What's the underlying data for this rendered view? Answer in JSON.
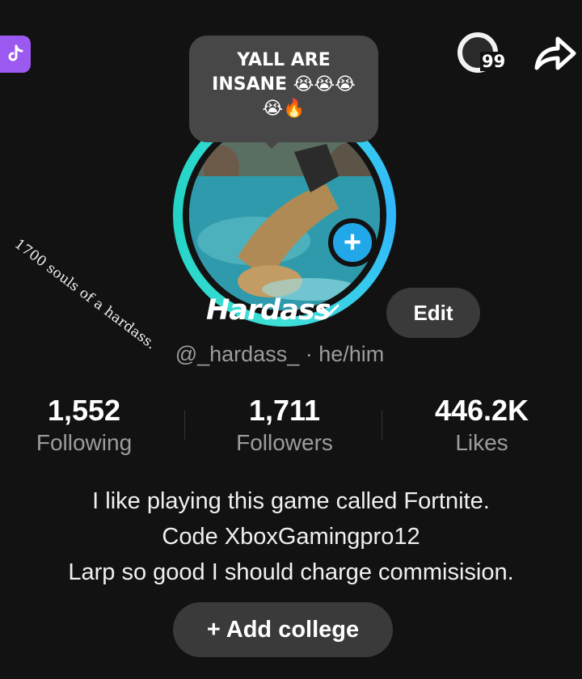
{
  "profile": {
    "display_name": "Hardass",
    "handle": "@_hardass_",
    "pronouns": "· he/him",
    "edit_label": "Edit"
  },
  "note": {
    "line1": "YALL ARE",
    "line2": "INSANE 😭😭😭",
    "line3": "😭🔥"
  },
  "overlay_text": "1700 souls of a hardass.",
  "header": {
    "notification_count": "99",
    "share_icon": "share-arrow-icon",
    "app_icon": "tiktok-icon"
  },
  "stats": [
    {
      "value": "1,552",
      "label": "Following"
    },
    {
      "value": "1,711",
      "label": "Followers"
    },
    {
      "value": "446.2K",
      "label": "Likes"
    }
  ],
  "bio": {
    "line1": "I like playing this game called Fortnite.",
    "line2": "Code XboxGamingpro12",
    "line3": "Larp so good I should charge commisision."
  },
  "add_college_label": "+ Add college",
  "colors": {
    "background": "#121212",
    "story_ring": "#3ee0d8",
    "plus_button": "#22a7e8",
    "tiktok_badge": "#9b59f0",
    "button_bg": "#3a3a3a",
    "secondary_text": "#9c9c9c"
  }
}
